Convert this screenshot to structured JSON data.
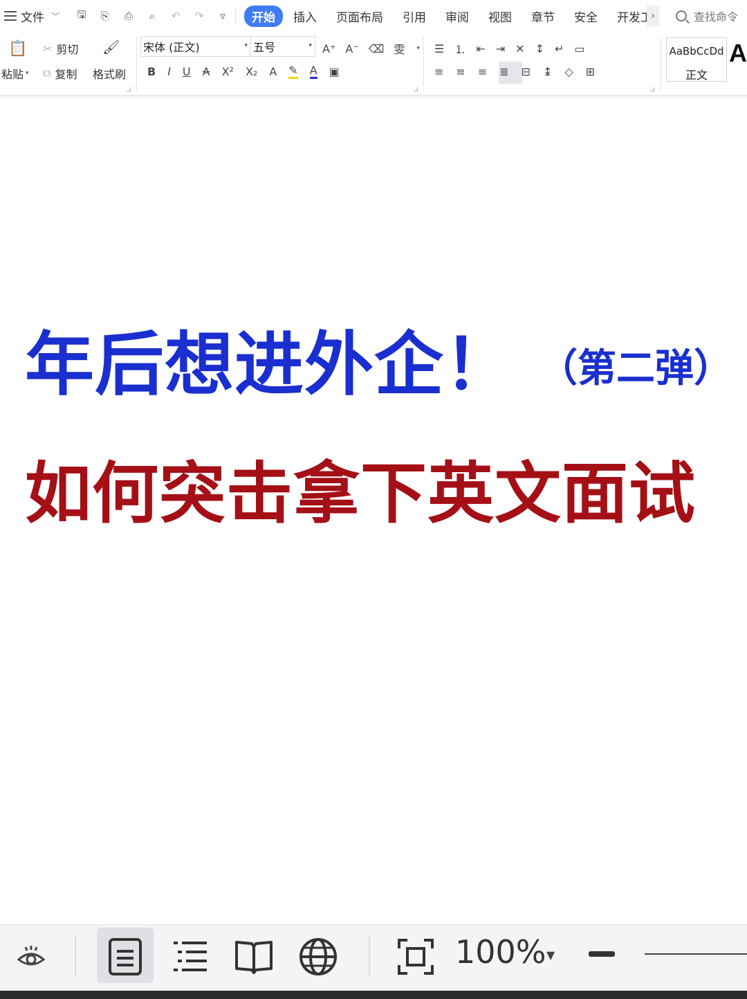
{
  "menubar": {
    "file_label": "文件",
    "tabs": [
      {
        "label": "开始",
        "active": true
      },
      {
        "label": "插入",
        "active": false
      },
      {
        "label": "页面布局",
        "active": false
      },
      {
        "label": "引用",
        "active": false
      },
      {
        "label": "审阅",
        "active": false
      },
      {
        "label": "视图",
        "active": false
      },
      {
        "label": "章节",
        "active": false
      },
      {
        "label": "安全",
        "active": false
      },
      {
        "label": "开发工",
        "active": false
      }
    ],
    "search_label": "查找命令",
    "accent_color": "#3f7cf5"
  },
  "ribbon": {
    "paste_label": "粘贴",
    "cut_label": "剪切",
    "copy_label": "复制",
    "format_painter_label": "格式刷",
    "font_name": "宋体 (正文)",
    "font_size": "五号",
    "style_sample": "AaBbCcDd",
    "style_name": "正文",
    "style_next_sample": "A"
  },
  "document": {
    "title_main": "年后想进外企！",
    "title_sub": "（第二弹）",
    "subtitle": "如何突击拿下英文面试",
    "title_color": "#1a2fd0",
    "subtitle_color": "#a50f16"
  },
  "statusbar": {
    "zoom": "100%"
  }
}
